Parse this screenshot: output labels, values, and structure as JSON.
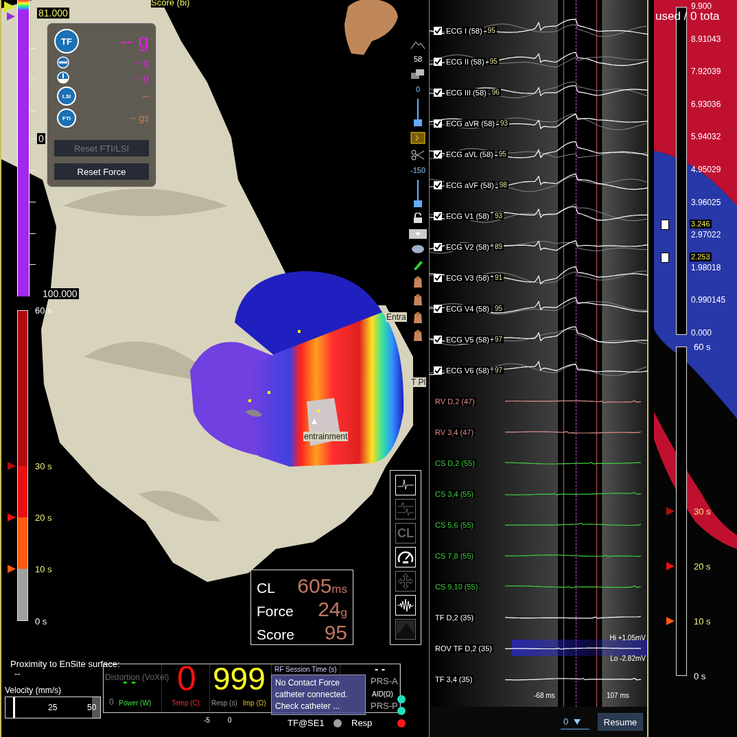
{
  "map": {
    "scale": {
      "title": "Score (bi)",
      "top_value": "81.000",
      "zero_label": "0",
      "bottom_value": "100.000"
    },
    "force_panel": {
      "rows": [
        {
          "kind": "tf",
          "icon_text": "TF",
          "value": "--",
          "unit": "g"
        },
        {
          "kind": "axial",
          "value": "--",
          "unit": "g"
        },
        {
          "kind": "lateral",
          "value": "--",
          "unit": "g"
        },
        {
          "kind": "lsi",
          "icon_text": "LSI",
          "value": "--"
        },
        {
          "kind": "fti",
          "icon_text": "FTI",
          "value": "--",
          "unit": "gs"
        }
      ],
      "buttons": [
        {
          "label": "Reset FTI/LSI",
          "disabled": true
        },
        {
          "label": "Reset Force",
          "disabled": false
        }
      ]
    },
    "timer": {
      "filled": true,
      "ticks": [
        {
          "label": "60 s"
        },
        {
          "label": "30 s",
          "color": "#b00c0c"
        },
        {
          "label": "20 s",
          "color": "#e81010"
        },
        {
          "label": "10 s",
          "color": "#ff5a10"
        },
        {
          "label": "0 s"
        }
      ]
    },
    "labels": [
      {
        "kind": "edge",
        "text": "Entra"
      },
      {
        "kind": "side",
        "text": "T Pl"
      },
      {
        "kind": "site",
        "text": "entrainment"
      }
    ],
    "toolbar": {
      "readouts": [
        "58",
        "0",
        "-150"
      ]
    },
    "tool_buttons": [
      {
        "kind": "wave",
        "disabled": false
      },
      {
        "kind": "double-wave",
        "disabled": true
      },
      {
        "kind": "text",
        "label": "CL",
        "disabled": true
      },
      {
        "kind": "gauge",
        "disabled": false
      },
      {
        "kind": "move",
        "disabled": true
      },
      {
        "kind": "burst",
        "disabled": false
      },
      {
        "kind": "image",
        "disabled": true
      }
    ],
    "metrics": [
      {
        "label": "CL",
        "value": "605",
        "unit": "ms"
      },
      {
        "label": "Force",
        "value": "24",
        "unit": "g"
      },
      {
        "label": "Score",
        "value": "95"
      }
    ]
  },
  "status": {
    "proximity_label": "Proximity to EnSite surface:",
    "proximity_value": "--",
    "velocity": {
      "label": "Velocity (mm/s)",
      "ticks": [
        "25",
        "50"
      ],
      "level": 0.08
    },
    "ablation": {
      "distortion_label": "Distortion (VoXel)",
      "power_value": "- -",
      "power_label": "Power (W)",
      "power_tick": "0",
      "temp_value": "0",
      "temp_label": "Temp (C)",
      "resp_label": "Resp (s)",
      "resp_ticks": [
        "-5",
        "0"
      ],
      "imp_value": "999",
      "imp_label": "Imp (Ω)",
      "rf_label": "RF Session Time (s)",
      "aid_value": "- -",
      "aid_label": "AID(Ω)"
    },
    "prs": [
      {
        "label": "PRS-A",
        "color": "#20e0c0"
      },
      {
        "label": "PRS-P",
        "color": "#20e0c0"
      }
    ],
    "tooltip": [
      "No Contact Force",
      "catheter connected.",
      "Check catheter ..."
    ],
    "indicators": [
      {
        "label": "TF@SE1",
        "color": "#a0a0a0"
      },
      {
        "label": "Resp",
        "color": "#ff1a1a"
      }
    ]
  },
  "ecg": {
    "channels": [
      {
        "kind": "ecg",
        "name": "ECG I (58)",
        "value": "95",
        "checked": true,
        "color": "#ffffff"
      },
      {
        "kind": "ecg",
        "name": "ECG II (58)",
        "value": "95",
        "checked": true,
        "color": "#ffffff"
      },
      {
        "kind": "ecg",
        "name": "ECG III (58)",
        "value": "96",
        "checked": true,
        "color": "#ffffff"
      },
      {
        "kind": "ecg",
        "name": "ECG aVR (58)",
        "value": "93",
        "checked": true,
        "color": "#ffffff"
      },
      {
        "kind": "ecg",
        "name": "ECG aVL (58)",
        "value": "95",
        "checked": true,
        "color": "#ffffff"
      },
      {
        "kind": "ecg",
        "name": "ECG aVF (58)",
        "value": "98",
        "checked": true,
        "color": "#ffffff"
      },
      {
        "kind": "ecg",
        "name": "ECG V1 (58)",
        "value": "93",
        "checked": true,
        "color": "#ffffff"
      },
      {
        "kind": "ecg",
        "name": "ECG V2 (58)",
        "value": "89",
        "checked": true,
        "color": "#ffffff"
      },
      {
        "kind": "ecg",
        "name": "ECG V3 (58)",
        "value": "91",
        "checked": true,
        "color": "#ffffff"
      },
      {
        "kind": "ecg",
        "name": "ECG V4 (58)",
        "value": "95",
        "checked": true,
        "color": "#ffffff"
      },
      {
        "kind": "ecg",
        "name": "ECG V5 (58)",
        "value": "97",
        "checked": true,
        "color": "#ffffff"
      },
      {
        "kind": "ecg",
        "name": "ECG V6 (58)",
        "value": "97",
        "checked": true,
        "color": "#ffffff"
      },
      {
        "kind": "bipolar",
        "name": "RV D,2 (47)",
        "color": "#e08c8c"
      },
      {
        "kind": "bipolar",
        "name": "RV 3,4 (47)",
        "color": "#e08c8c"
      },
      {
        "kind": "bipolar",
        "name": "CS D,2 (55)",
        "color": "#40d040"
      },
      {
        "kind": "bipolar",
        "name": "CS 3,4 (55)",
        "color": "#40d040"
      },
      {
        "kind": "bipolar",
        "name": "CS 5,6 (55)",
        "color": "#40d040"
      },
      {
        "kind": "bipolar",
        "name": "CS 7,8 (55)",
        "color": "#40d040"
      },
      {
        "kind": "bipolar",
        "name": "CS 9,10 (55)",
        "color": "#40d040"
      },
      {
        "kind": "bipolar",
        "name": "TF D,2 (35)",
        "color": "#ffffff"
      },
      {
        "kind": "rov",
        "name": "ROV TF D,2 (35)",
        "color": "#ffffff",
        "hi": "Hi +1.05mV",
        "lo": "Lo -2.82mV"
      },
      {
        "kind": "bipolar",
        "name": "TF 3,4 (35)",
        "color": "#ffffff"
      }
    ],
    "window_markers": [
      "-68 ms",
      "107 ms"
    ],
    "controls": {
      "dropdown_value": "0",
      "resume": "Resume"
    }
  },
  "right": {
    "header": "used / 0 tota",
    "scale_values": [
      "9.900",
      "8.91043",
      "7.92039",
      "6.93036",
      "5.94032",
      "4.95029",
      "3.96025",
      "2.97022",
      "1.98018",
      "0.990145",
      "0.000"
    ],
    "markers": [
      "3.246",
      "2.253"
    ],
    "timer": {
      "filled": false,
      "ticks": [
        {
          "label": "60 s"
        },
        {
          "label": "30 s",
          "color": "#b00c0c"
        },
        {
          "label": "20 s",
          "color": "#e81010"
        },
        {
          "label": "10 s",
          "color": "#ff5a10"
        },
        {
          "label": "0 s"
        }
      ]
    }
  }
}
